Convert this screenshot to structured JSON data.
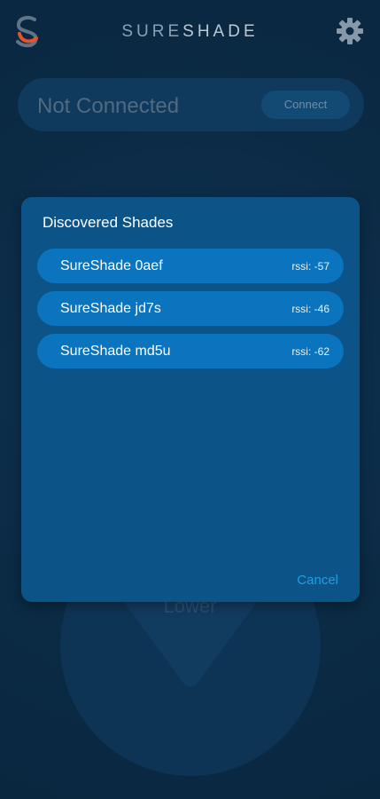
{
  "header": {
    "brand_part1": "SURE",
    "brand_part2": "SHADE",
    "logo_icon": "sureshade-logo-icon",
    "settings_icon": "gear-icon"
  },
  "connection": {
    "status": "Not Connected",
    "connect_label": "Connect"
  },
  "background": {
    "lower_label": "Lower"
  },
  "dialog": {
    "title": "Discovered Shades",
    "items": [
      {
        "name": "SureShade 0aef",
        "rssi": "rssi: -57"
      },
      {
        "name": "SureShade jd7s",
        "rssi": "rssi: -46"
      },
      {
        "name": "SureShade md5u",
        "rssi": "rssi: -62"
      }
    ],
    "cancel_label": "Cancel"
  },
  "colors": {
    "background": "#0b2a44",
    "dialog": "#0c5487",
    "list_item": "#0a74be",
    "accent": "#1f9ee8",
    "logo_orange": "#e5532a"
  }
}
